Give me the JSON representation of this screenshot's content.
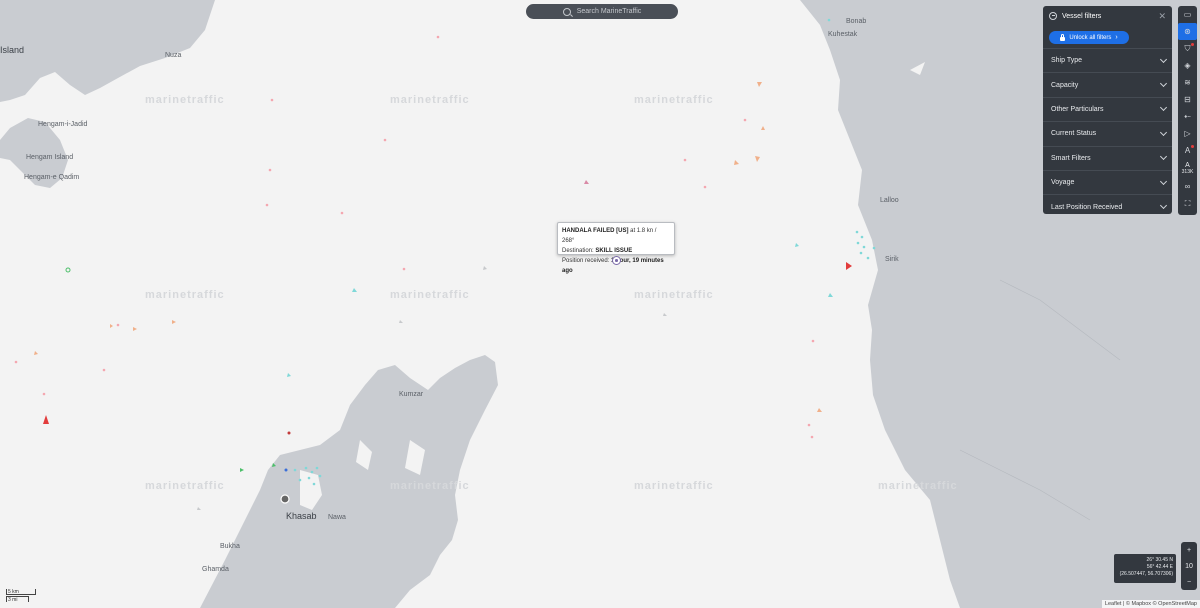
{
  "search": {
    "placeholder": "Search MarineTraffic"
  },
  "watermark": "marinetraffic",
  "tooltip": {
    "vessel_name": "HANDALA FAILED [US]",
    "speed_course": "at 1.8 kn / 268°",
    "destination_label": "Destination:",
    "destination_value": "SKILL ISSUE",
    "position_label": "Position received:",
    "position_value": "1 hour, 19 minutes ago"
  },
  "filters_panel": {
    "title": "Vessel filters",
    "close": "✕",
    "unlock_label": "Unlock all filters",
    "items": [
      "Ship Type",
      "Capacity",
      "Other Particulars",
      "Current Status",
      "Smart Filters",
      "Voyage",
      "Last Position Received"
    ]
  },
  "toolbar": {
    "count_icon": "A",
    "count": "313K",
    "icons": [
      "map-layer-icon",
      "filter-icon",
      "shield-icon",
      "layers-icon",
      "weather-icon",
      "ruler-icon",
      "compass-icon",
      "play-icon",
      "text-label-icon",
      "sailing-icon",
      "link-icon",
      "fullscreen-icon"
    ]
  },
  "zoom": {
    "in": "+",
    "level": "10",
    "out": "−"
  },
  "coordinates": {
    "lat": "26° 30.45 N",
    "lon": "56° 42.44 E",
    "decimal": "(26.507447, 56.707306)"
  },
  "attribution": "Leaflet | © Mapbox © OpenStreetMap",
  "scale": {
    "km": "5 km",
    "mi": "3 mi"
  },
  "places": {
    "island": "Island",
    "hengam_island": "Hengam Island",
    "hengam": "Hengam-i-Jadid",
    "hengam_qadim": "Hengam-e Qadim",
    "nuza": "Nuza",
    "kuhestak": "Kuhestak",
    "bonab": "Bonab",
    "kumzar": "Kumzar",
    "khasab": "Khasab",
    "bukha": "Bukha",
    "ghamda": "Ghamda",
    "nawa": "Nawa",
    "lalloo": "Lalloo",
    "sirik": "Sirik"
  },
  "colors": {
    "sea": "#f3f3f3",
    "land": "#c9ccd1",
    "panel": "#33383f",
    "accent": "#1e6fe6"
  }
}
